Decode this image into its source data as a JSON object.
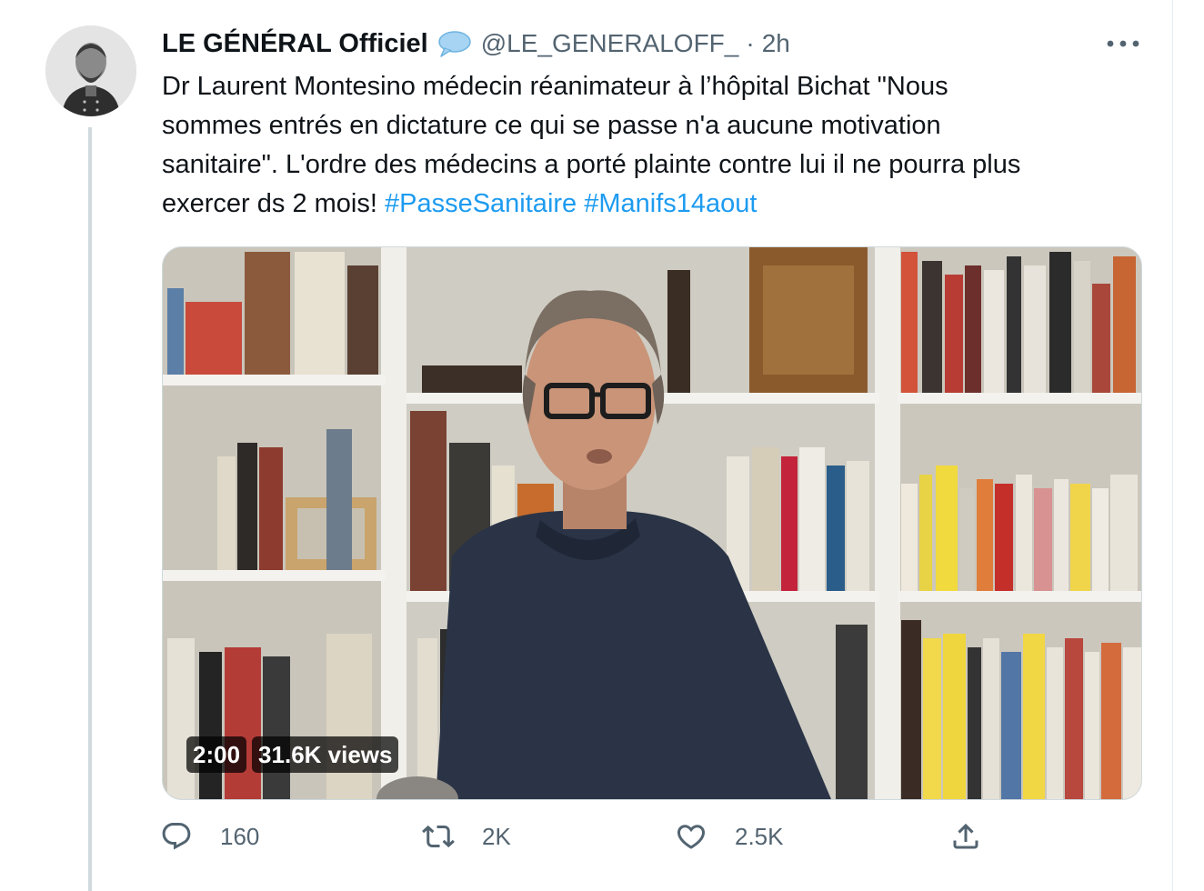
{
  "tweet": {
    "display_name": "LE GÉNÉRAL Officiel",
    "badge_icon": "speech-bubble-icon",
    "handle": "@LE_GENERALOFF_",
    "separator": "·",
    "time": "2h",
    "text_lines": [
      "Dr Laurent Montesino médecin réanimateur à l’hôpital Bichat \"Nous",
      "sommes entrés en dictature ce qui se passe n'a aucune motivation",
      "sanitaire\". L'ordre des médecins a porté plainte contre lui il ne pourra plus",
      "exercer ds 2 mois! "
    ],
    "hashtags": [
      "#PasseSanitaire",
      "#Manifs14aout"
    ],
    "video": {
      "duration": "2:00",
      "views": "31.6K views"
    },
    "actions": {
      "reply_count": "160",
      "retweet_count": "2K",
      "like_count": "2.5K"
    }
  },
  "colors": {
    "link": "#1d9bf0",
    "secondary_text": "#536471",
    "primary_text": "#0f1419"
  }
}
